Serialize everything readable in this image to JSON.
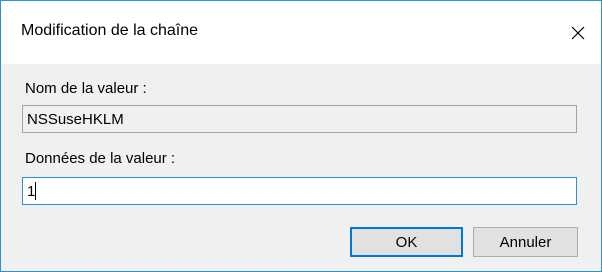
{
  "dialog": {
    "title": "Modification de la chaîne",
    "close_icon": "close-icon",
    "accent_color": "#2b93d5"
  },
  "value_name": {
    "label": "Nom de la valeur :",
    "value": "NSSuseHKLM"
  },
  "value_data": {
    "label": "Données de la valeur :",
    "value": "1"
  },
  "buttons": {
    "ok_label": "OK",
    "cancel_label": "Annuler"
  }
}
